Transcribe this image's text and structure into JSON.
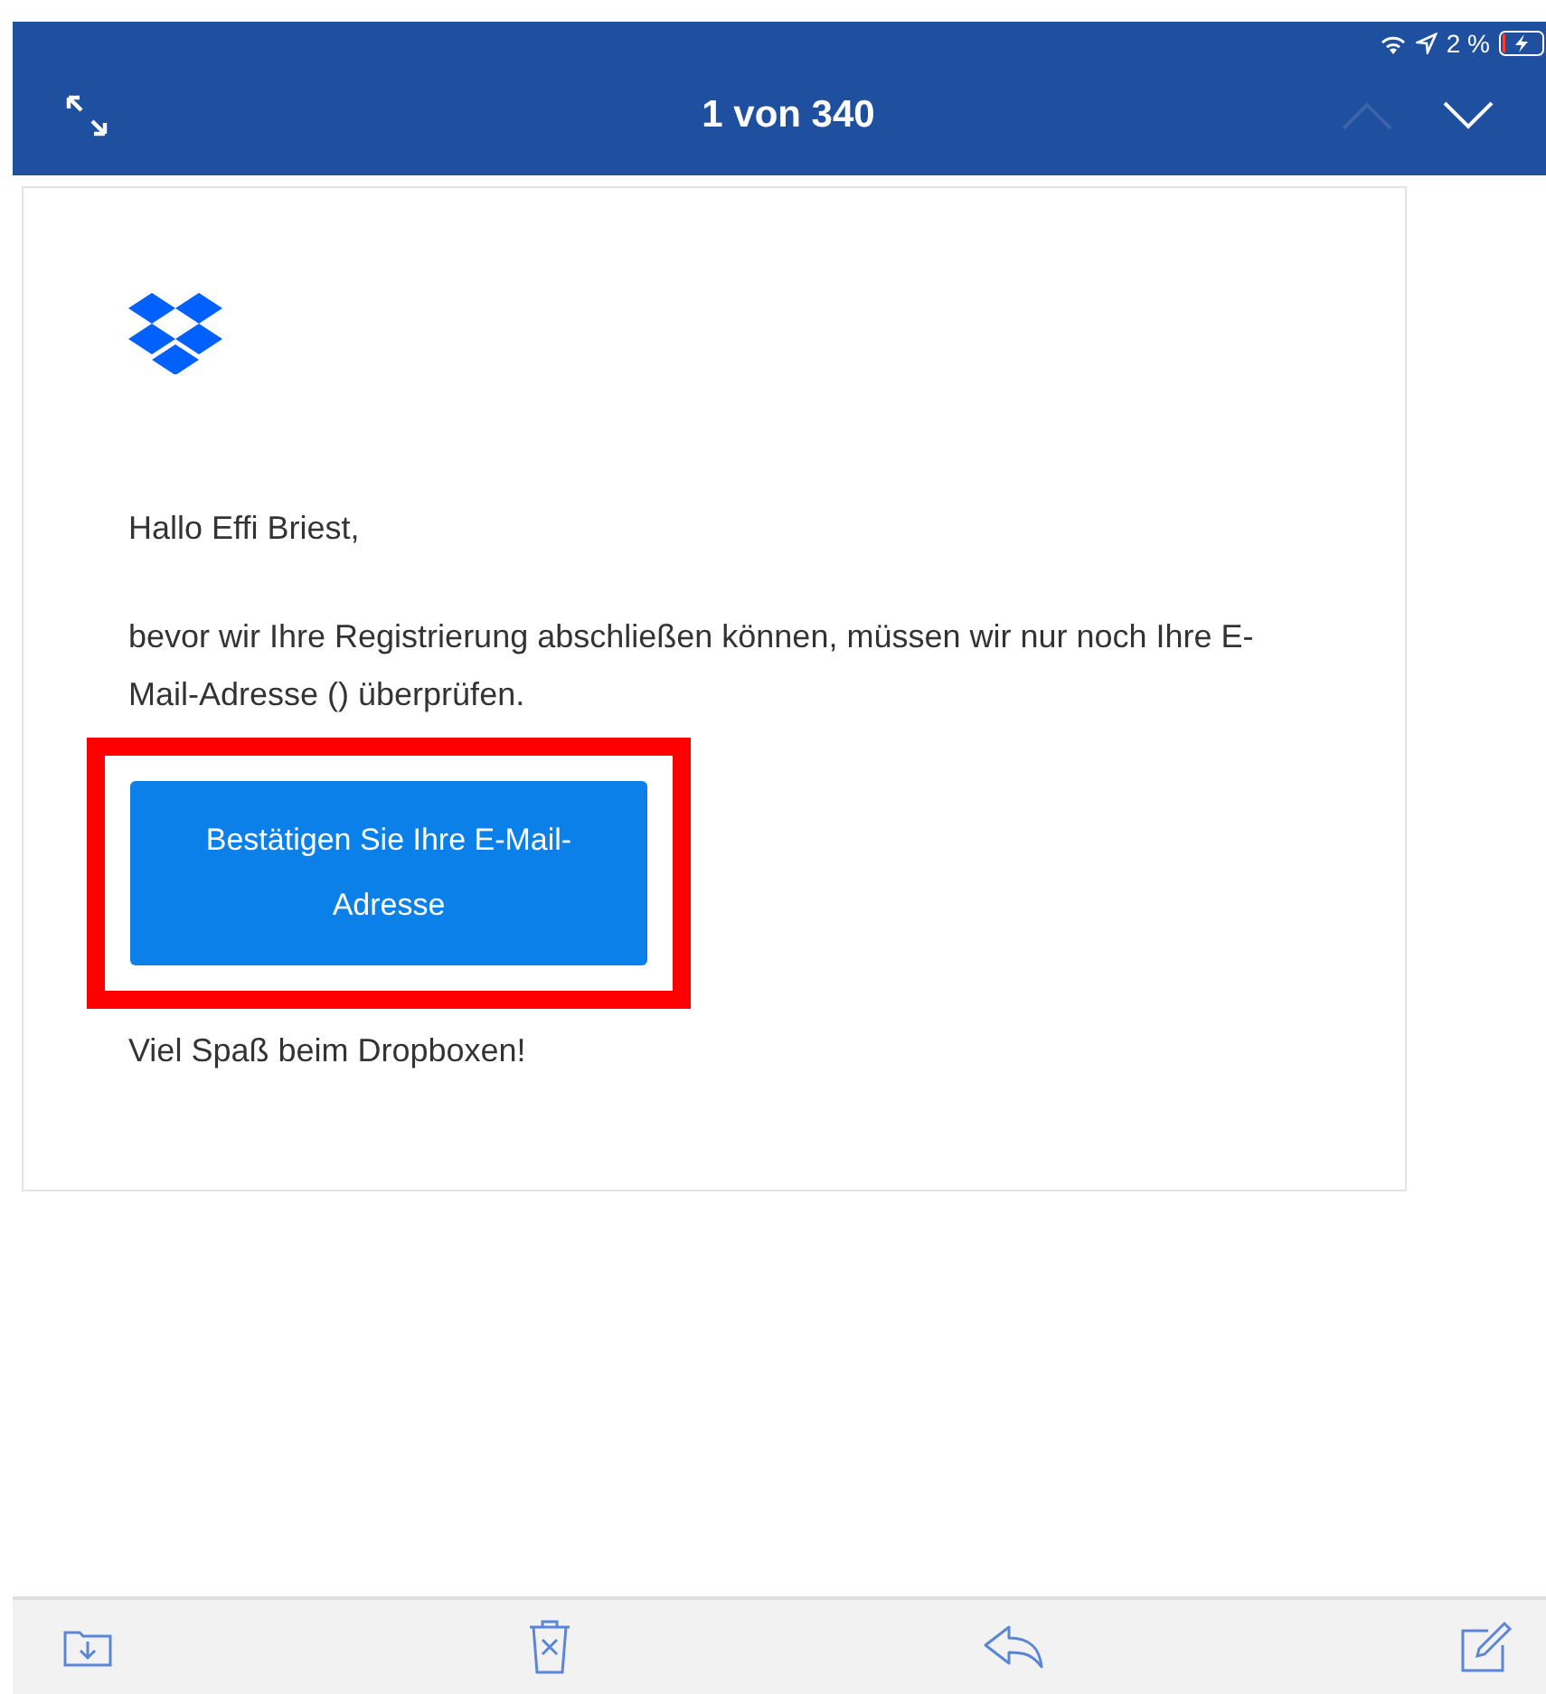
{
  "status_bar": {
    "battery_percent": "2 %"
  },
  "nav_bar": {
    "title": "1 von 340",
    "previous": {
      "disabled": true
    },
    "next": {
      "disabled": false
    }
  },
  "email": {
    "greeting": "Hallo Effi Briest,",
    "body": "bevor wir Ihre Registrierung abschließen können, müssen wir nur noch Ihre E-Mail-Adresse () überprüfen.",
    "button": {
      "label": "Bestätigen Sie Ihre E-Mail-Adresse",
      "highlighted": true
    },
    "closing": "Viel Spaß beim Dropboxen!"
  },
  "toolbar": [
    {
      "kind": "move"
    },
    {
      "kind": "delete"
    },
    {
      "kind": "reply"
    },
    {
      "kind": "compose"
    }
  ]
}
